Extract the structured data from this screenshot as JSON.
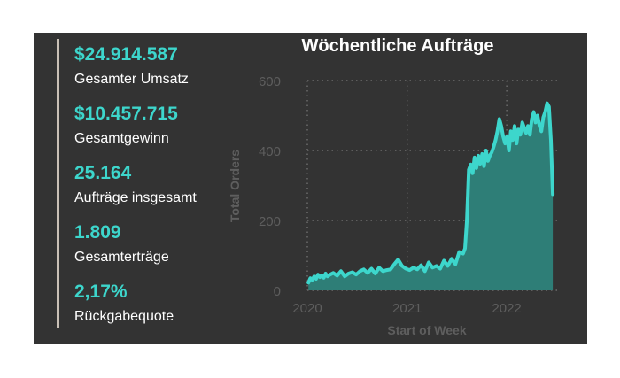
{
  "kpis": [
    {
      "value": "$24.914.587",
      "label": "Gesamter Umsatz"
    },
    {
      "value": "$10.457.715",
      "label": "Gesamtgewinn"
    },
    {
      "value": "25.164",
      "label": "Aufträge insgesamt"
    },
    {
      "value": "1.809",
      "label": "Gesamterträge"
    },
    {
      "value": "2,17%",
      "label": "Rückgabequote"
    }
  ],
  "colors": {
    "accent": "#3dd6cc",
    "area_fill": "#2e7e77",
    "panel_bg": "#333333",
    "axis_text": "#5e5e5e",
    "grid": "#777777",
    "divider": "#c9c0b6"
  },
  "chart_data": {
    "type": "area",
    "title": "Wöchentliche Aufträge",
    "xlabel": "Start of Week",
    "ylabel": "Total Orders",
    "ylim": [
      0,
      600
    ],
    "yticks": [
      0,
      200,
      400,
      600
    ],
    "xlim": [
      "2020-01-01",
      "2022-07-08"
    ],
    "xticks": [
      {
        "date": "2020-01-01",
        "label": "2020"
      },
      {
        "date": "2021-01-01",
        "label": "2021"
      },
      {
        "date": "2022-01-01",
        "label": "2022"
      }
    ],
    "grid": true,
    "series": [
      {
        "values": [
          [
            "2020-01-05",
            22
          ],
          [
            "2020-01-12",
            35
          ],
          [
            "2020-01-19",
            30
          ],
          [
            "2020-01-26",
            40
          ],
          [
            "2020-02-02",
            33
          ],
          [
            "2020-02-09",
            45
          ],
          [
            "2020-02-16",
            38
          ],
          [
            "2020-02-23",
            42
          ],
          [
            "2020-03-01",
            36
          ],
          [
            "2020-03-08",
            48
          ],
          [
            "2020-03-15",
            40
          ],
          [
            "2020-03-22",
            44
          ],
          [
            "2020-04-05",
            50
          ],
          [
            "2020-04-19",
            42
          ],
          [
            "2020-05-03",
            55
          ],
          [
            "2020-05-17",
            40
          ],
          [
            "2020-05-31",
            48
          ],
          [
            "2020-06-14",
            52
          ],
          [
            "2020-06-28",
            45
          ],
          [
            "2020-07-12",
            55
          ],
          [
            "2020-07-26",
            60
          ],
          [
            "2020-08-09",
            50
          ],
          [
            "2020-08-23",
            62
          ],
          [
            "2020-09-06",
            48
          ],
          [
            "2020-09-20",
            65
          ],
          [
            "2020-10-04",
            55
          ],
          [
            "2020-10-18",
            58
          ],
          [
            "2020-11-01",
            60
          ],
          [
            "2020-11-15",
            75
          ],
          [
            "2020-11-29",
            88
          ],
          [
            "2020-12-13",
            70
          ],
          [
            "2020-12-27",
            62
          ],
          [
            "2021-01-10",
            58
          ],
          [
            "2021-01-24",
            65
          ],
          [
            "2021-02-07",
            60
          ],
          [
            "2021-02-21",
            72
          ],
          [
            "2021-03-07",
            55
          ],
          [
            "2021-03-21",
            80
          ],
          [
            "2021-04-04",
            65
          ],
          [
            "2021-04-18",
            70
          ],
          [
            "2021-05-02",
            62
          ],
          [
            "2021-05-16",
            85
          ],
          [
            "2021-05-30",
            70
          ],
          [
            "2021-06-13",
            90
          ],
          [
            "2021-06-27",
            75
          ],
          [
            "2021-07-11",
            110
          ],
          [
            "2021-07-25",
            105
          ],
          [
            "2021-08-01",
            120
          ],
          [
            "2021-08-08",
            200
          ],
          [
            "2021-08-15",
            345
          ],
          [
            "2021-08-22",
            360
          ],
          [
            "2021-08-29",
            335
          ],
          [
            "2021-09-05",
            380
          ],
          [
            "2021-09-12",
            350
          ],
          [
            "2021-09-19",
            385
          ],
          [
            "2021-09-26",
            362
          ],
          [
            "2021-10-03",
            390
          ],
          [
            "2021-10-10",
            355
          ],
          [
            "2021-10-17",
            400
          ],
          [
            "2021-10-24",
            370
          ],
          [
            "2021-10-31",
            385
          ],
          [
            "2021-11-07",
            395
          ],
          [
            "2021-11-14",
            410
          ],
          [
            "2021-11-21",
            430
          ],
          [
            "2021-11-28",
            455
          ],
          [
            "2021-12-05",
            490
          ],
          [
            "2021-12-12",
            470
          ],
          [
            "2021-12-19",
            440
          ],
          [
            "2021-12-26",
            420
          ],
          [
            "2022-01-02",
            440
          ],
          [
            "2022-01-09",
            400
          ],
          [
            "2022-01-16",
            455
          ],
          [
            "2022-01-23",
            430
          ],
          [
            "2022-01-30",
            470
          ],
          [
            "2022-02-06",
            420
          ],
          [
            "2022-02-13",
            460
          ],
          [
            "2022-02-20",
            445
          ],
          [
            "2022-02-27",
            480
          ],
          [
            "2022-03-06",
            465
          ],
          [
            "2022-03-13",
            450
          ],
          [
            "2022-03-20",
            470
          ],
          [
            "2022-03-27",
            445
          ],
          [
            "2022-04-03",
            490
          ],
          [
            "2022-04-10",
            510
          ],
          [
            "2022-04-17",
            480
          ],
          [
            "2022-04-24",
            500
          ],
          [
            "2022-05-01",
            470
          ],
          [
            "2022-05-08",
            455
          ],
          [
            "2022-05-15",
            495
          ],
          [
            "2022-05-22",
            510
          ],
          [
            "2022-05-29",
            535
          ],
          [
            "2022-06-05",
            525
          ],
          [
            "2022-06-12",
            430
          ],
          [
            "2022-06-19",
            275
          ]
        ]
      }
    ]
  }
}
